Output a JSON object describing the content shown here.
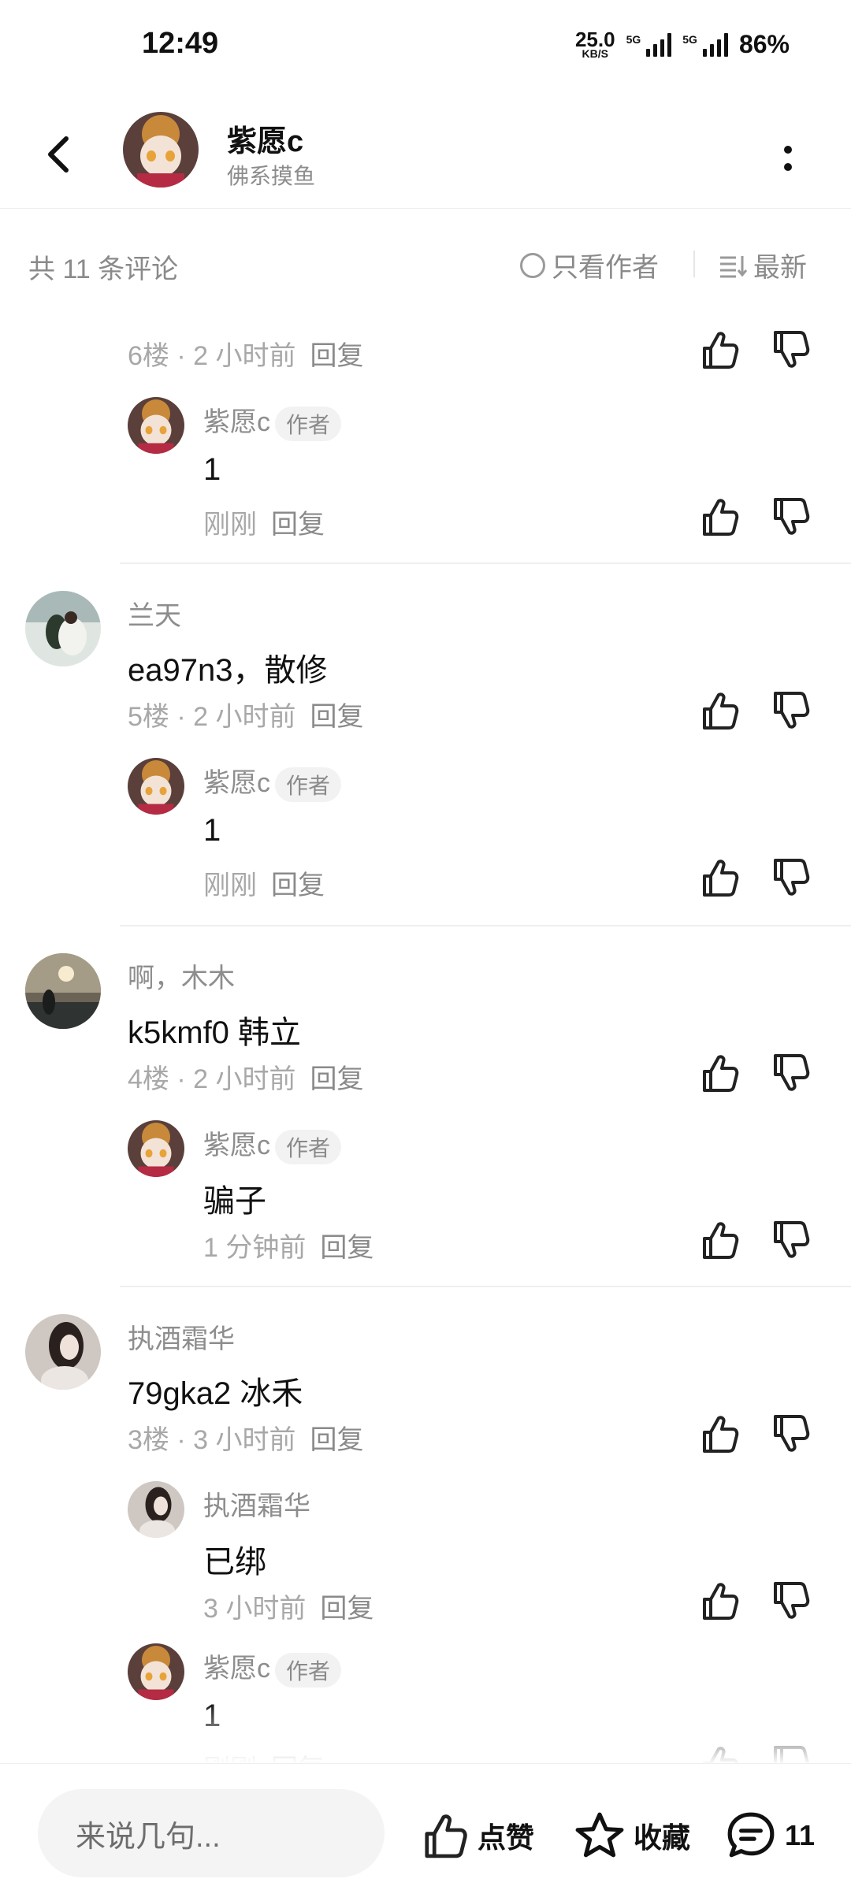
{
  "status": {
    "time": "12:49",
    "speed_value": "25.0",
    "speed_unit": "KB/S",
    "net1": "5G",
    "net2": "5G",
    "battery": "86%"
  },
  "header": {
    "name": "紫愿c",
    "subtitle": "佛系摸鱼"
  },
  "comments_header": {
    "count_text": "共 11 条评论",
    "author_only": "只看作者",
    "sort": "最新"
  },
  "floor6": {
    "meta": "6楼 · 2 小时前",
    "reply": "回复",
    "sub": {
      "name": "紫愿c",
      "tag": "作者",
      "text": "1",
      "time": "刚刚",
      "reply": "回复"
    }
  },
  "floor5": {
    "name": "兰天",
    "text": "ea97n3，散修",
    "meta": "5楼 · 2 小时前",
    "reply": "回复",
    "sub": {
      "name": "紫愿c",
      "tag": "作者",
      "text": "1",
      "time": "刚刚",
      "reply": "回复"
    }
  },
  "floor4": {
    "name": "啊，木木",
    "text": "k5kmf0 韩立",
    "meta": "4楼 · 2 小时前",
    "reply": "回复",
    "sub": {
      "name": "紫愿c",
      "tag": "作者",
      "text": "骗子",
      "time": "1 分钟前",
      "reply": "回复"
    }
  },
  "floor3": {
    "name": "执酒霜华",
    "text": "79gka2 冰禾",
    "meta": "3楼 · 3 小时前",
    "reply": "回复",
    "sub1": {
      "name": "执酒霜华",
      "text": "已绑",
      "time": "3 小时前",
      "reply": "回复"
    },
    "sub2": {
      "name": "紫愿c",
      "tag": "作者",
      "text": "1",
      "time": "刚刚",
      "reply": "回复"
    }
  },
  "bottom": {
    "input_placeholder": "来说几句...",
    "like": "点赞",
    "favorite": "收藏",
    "comments": "11"
  }
}
